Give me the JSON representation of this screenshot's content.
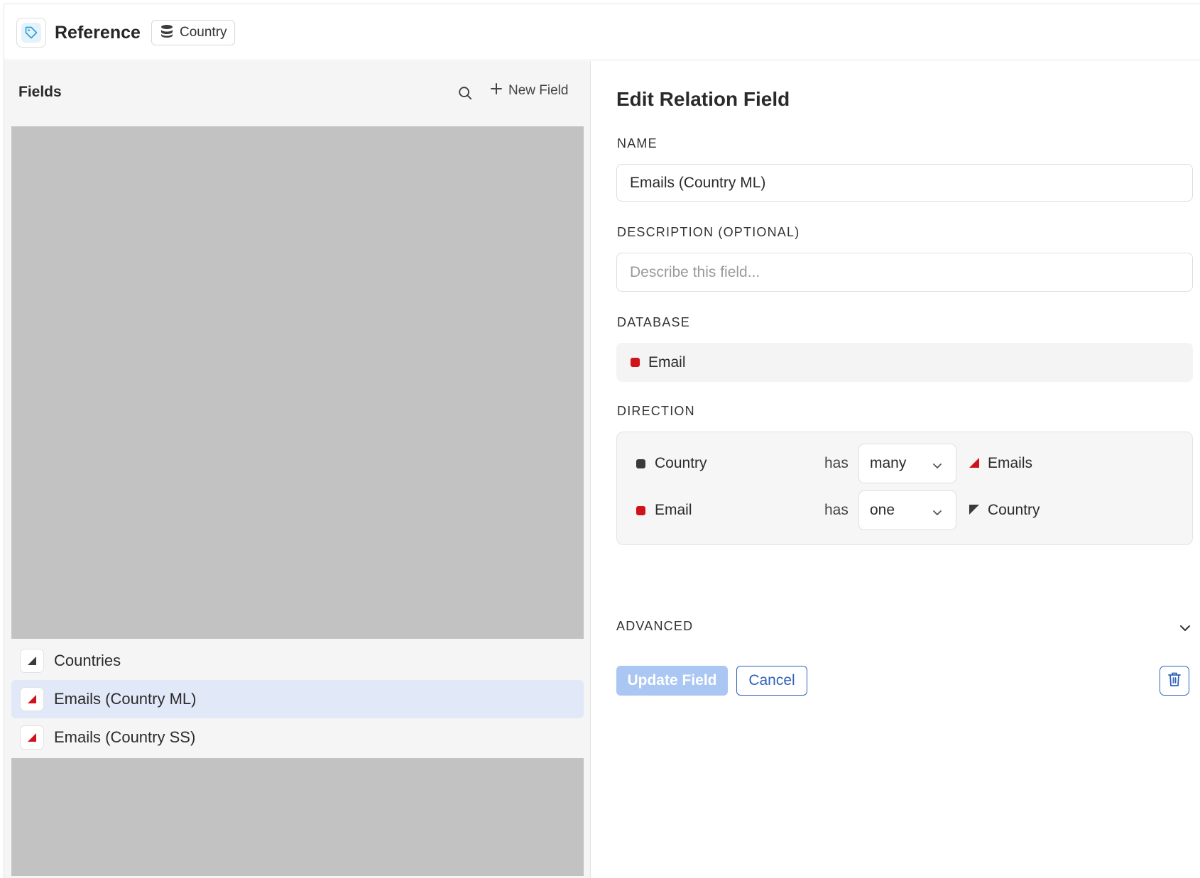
{
  "header": {
    "title": "Reference",
    "database_chip": "Country",
    "icons": {
      "title_icon": "tag-icon",
      "chip_icon": "database-icon"
    }
  },
  "sidebar": {
    "title": "Fields",
    "new_field_label": "New Field",
    "icons": {
      "search": "search-icon",
      "add": "plus-icon"
    },
    "items": [
      {
        "label": "Countries",
        "icon_color": "#3a3a3a",
        "selected": false
      },
      {
        "label": "Emails (Country ML)",
        "icon_color": "#d0121b",
        "selected": true
      },
      {
        "label": "Emails (Country SS)",
        "icon_color": "#d0121b",
        "selected": false
      }
    ]
  },
  "form": {
    "title": "Edit Relation Field",
    "name_label": "NAME",
    "name_value": "Emails (Country ML)",
    "description_label": "DESCRIPTION (OPTIONAL)",
    "description_placeholder": "Describe this field...",
    "database_label": "DATABASE",
    "database_value": "Email",
    "database_color": "#d0121b",
    "direction_label": "DIRECTION",
    "directions": [
      {
        "source": "Country",
        "source_color": "#3a3a3a",
        "verb": "has",
        "cardinality": "many",
        "target": "Emails",
        "target_color": "#d0121b"
      },
      {
        "source": "Email",
        "source_color": "#d0121b",
        "verb": "has",
        "cardinality": "one",
        "target": "Country",
        "target_color": "#3a3a3a"
      }
    ],
    "advanced_label": "ADVANCED",
    "update_button": "Update Field",
    "cancel_button": "Cancel",
    "icons": {
      "delete": "trash-icon",
      "expand": "chevron-down-icon"
    }
  },
  "colors": {
    "accent": "#2f63b9",
    "primary_disabled": "#a9c7f2",
    "selected_row": "#e1e8f7",
    "relation_red": "#d0121b"
  }
}
